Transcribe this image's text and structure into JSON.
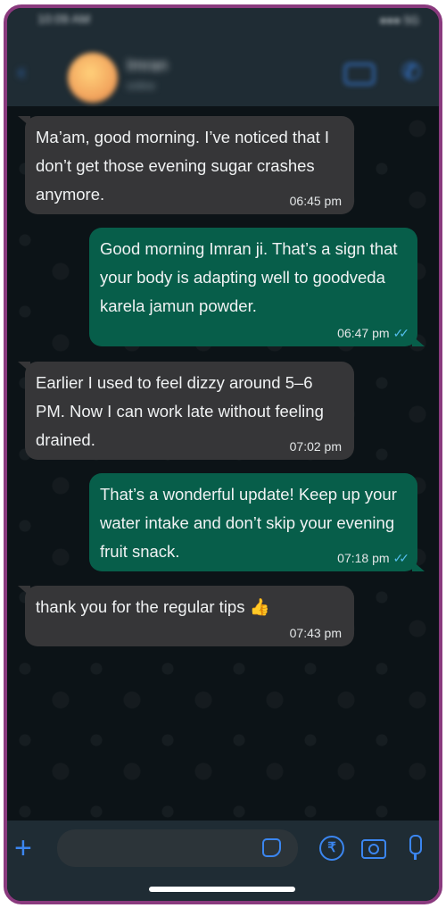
{
  "status_bar": {
    "time": "10:09 AM",
    "icons": "●●● 5G"
  },
  "header": {
    "contact_name": "Imran",
    "contact_status": "online"
  },
  "messages": [
    {
      "direction": "incoming",
      "text": "Ma’am, good morning. I’ve noticed that I don’t get those evening sugar crashes anymore.",
      "time": "06:45 pm"
    },
    {
      "direction": "outgoing",
      "text": "Good morning Imran ji. That’s a sign that your body is adapting well to goodveda karela jamun powder.",
      "time": "06:47 pm",
      "status": "read"
    },
    {
      "direction": "incoming",
      "text": "Earlier I used to feel dizzy around 5–6 PM. Now I can work late without feeling drained.",
      "time": "07:02 pm"
    },
    {
      "direction": "outgoing",
      "text": "That’s a wonderful update! Keep up your water intake and don’t skip your evening fruit snack.",
      "time": "07:18 pm",
      "status": "read"
    },
    {
      "direction": "incoming",
      "text": "thank you for the regular tips 👍",
      "time": "07:43 pm"
    }
  ],
  "read_tick": "✓✓",
  "composer": {
    "input_value": "",
    "rupee_symbol": "₹"
  },
  "colors": {
    "frame": "#8a3a7e",
    "chat_background": "#0c1317",
    "incoming_bubble": "#363638",
    "outgoing_bubble": "#075e4a",
    "accent": "#3b86f0",
    "read_tick": "#53bdeb"
  },
  "icons": [
    "back-arrow-icon",
    "video-call-icon",
    "phone-call-icon",
    "plus-icon",
    "sticker-icon",
    "rupee-payment-icon",
    "camera-icon",
    "microphone-icon"
  ]
}
